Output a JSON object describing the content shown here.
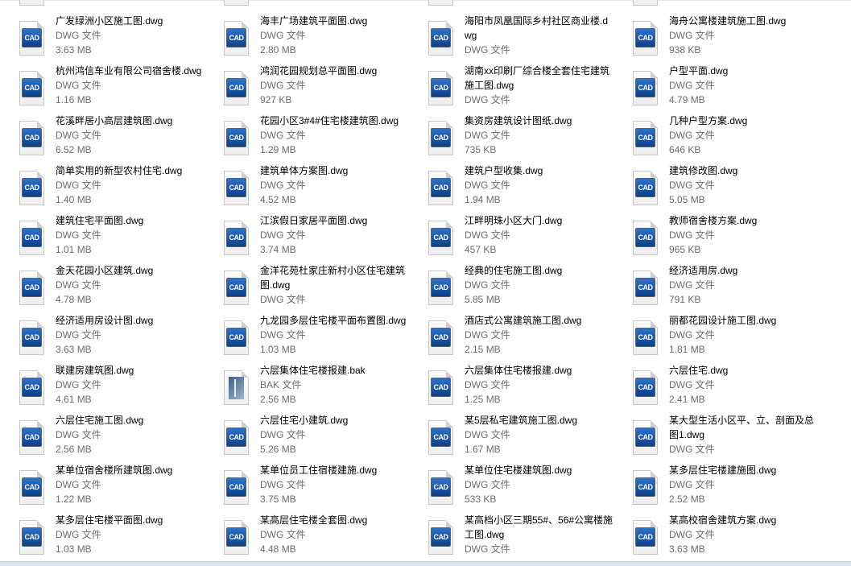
{
  "window": {
    "view": "tiles"
  },
  "icons": {
    "dwg": "cad-file-icon",
    "bak": "bak-file-icon",
    "cad_label": "CAD"
  },
  "colors": {
    "cad_blue": "#1f5cb0",
    "secondary_text": "#6d6d6d",
    "status_bar": "#dbe5f1"
  },
  "files": [
    {
      "name": "广发绿洲小区施工图.dwg",
      "type": "DWG 文件",
      "size": "3.63 MB",
      "kind": "dwg"
    },
    {
      "name": "海丰广场建筑平面图.dwg",
      "type": "DWG 文件",
      "size": "2.80 MB",
      "kind": "dwg"
    },
    {
      "name": "海阳市凤凰国际乡村社区商业楼.dwg",
      "type": "DWG 文件",
      "size": "",
      "kind": "dwg"
    },
    {
      "name": "海舟公寓楼建筑施工图.dwg",
      "type": "DWG 文件",
      "size": "938 KB",
      "kind": "dwg"
    },
    {
      "name": "杭州鸿信车业有限公司宿舍楼.dwg",
      "type": "DWG 文件",
      "size": "1.16 MB",
      "kind": "dwg"
    },
    {
      "name": "鸿润花园规划总平面图.dwg",
      "type": "DWG 文件",
      "size": "927 KB",
      "kind": "dwg"
    },
    {
      "name": "湖南xx印刷厂综合楼全套住宅建筑施工图.dwg",
      "type": "DWG 文件",
      "size": "",
      "kind": "dwg"
    },
    {
      "name": "户型平面.dwg",
      "type": "DWG 文件",
      "size": "4.79 MB",
      "kind": "dwg"
    },
    {
      "name": "花溪畔居小高层建筑图.dwg",
      "type": "DWG 文件",
      "size": "6.52 MB",
      "kind": "dwg"
    },
    {
      "name": "花园小区3#4#住宅楼建筑图.dwg",
      "type": "DWG 文件",
      "size": "1.29 MB",
      "kind": "dwg"
    },
    {
      "name": "集资房建筑设计图纸.dwg",
      "type": "DWG 文件",
      "size": "735 KB",
      "kind": "dwg"
    },
    {
      "name": "几种户型方案.dwg",
      "type": "DWG 文件",
      "size": "646 KB",
      "kind": "dwg"
    },
    {
      "name": "简单实用的新型农村住宅.dwg",
      "type": "DWG 文件",
      "size": "1.40 MB",
      "kind": "dwg"
    },
    {
      "name": "建筑单体方案图.dwg",
      "type": "DWG 文件",
      "size": "4.52 MB",
      "kind": "dwg"
    },
    {
      "name": "建筑户型收集.dwg",
      "type": "DWG 文件",
      "size": "1.94 MB",
      "kind": "dwg"
    },
    {
      "name": "建筑修改图.dwg",
      "type": "DWG 文件",
      "size": "5.05 MB",
      "kind": "dwg"
    },
    {
      "name": "建筑住宅平面图.dwg",
      "type": "DWG 文件",
      "size": "1.01 MB",
      "kind": "dwg"
    },
    {
      "name": "江滨假日家居平面图.dwg",
      "type": "DWG 文件",
      "size": "3.74 MB",
      "kind": "dwg"
    },
    {
      "name": "江畔明珠小区大门.dwg",
      "type": "DWG 文件",
      "size": "457 KB",
      "kind": "dwg"
    },
    {
      "name": "教师宿舍楼方案.dwg",
      "type": "DWG 文件",
      "size": "965 KB",
      "kind": "dwg"
    },
    {
      "name": "金天花园小区建筑.dwg",
      "type": "DWG 文件",
      "size": "4.78 MB",
      "kind": "dwg"
    },
    {
      "name": "金洋花苑杜家庄新村小区住宅建筑图.dwg",
      "type": "DWG 文件",
      "size": "",
      "kind": "dwg"
    },
    {
      "name": "经典的住宅施工图.dwg",
      "type": "DWG 文件",
      "size": "5.85 MB",
      "kind": "dwg"
    },
    {
      "name": "经济适用房.dwg",
      "type": "DWG 文件",
      "size": "791 KB",
      "kind": "dwg"
    },
    {
      "name": "经济适用房设计图.dwg",
      "type": "DWG 文件",
      "size": "3.63 MB",
      "kind": "dwg"
    },
    {
      "name": "九龙园多层住宅楼平面布置图.dwg",
      "type": "DWG 文件",
      "size": "1.03 MB",
      "kind": "dwg"
    },
    {
      "name": "酒店式公寓建筑施工图.dwg",
      "type": "DWG 文件",
      "size": "2.15 MB",
      "kind": "dwg"
    },
    {
      "name": "丽都花园设计施工图.dwg",
      "type": "DWG 文件",
      "size": "1.81 MB",
      "kind": "dwg"
    },
    {
      "name": "联建房建筑图.dwg",
      "type": "DWG 文件",
      "size": "4.61 MB",
      "kind": "dwg"
    },
    {
      "name": "六层集体住宅楼报建.bak",
      "type": "BAK 文件",
      "size": "2.56 MB",
      "kind": "bak"
    },
    {
      "name": "六层集体住宅楼报建.dwg",
      "type": "DWG 文件",
      "size": "1.25 MB",
      "kind": "dwg"
    },
    {
      "name": "六层住宅.dwg",
      "type": "DWG 文件",
      "size": "2.41 MB",
      "kind": "dwg"
    },
    {
      "name": "六层住宅施工图.dwg",
      "type": "DWG 文件",
      "size": "2.56 MB",
      "kind": "dwg"
    },
    {
      "name": "六层住宅小建筑.dwg",
      "type": "DWG 文件",
      "size": "5.26 MB",
      "kind": "dwg"
    },
    {
      "name": "某5层私宅建筑施工图.dwg",
      "type": "DWG 文件",
      "size": "1.67 MB",
      "kind": "dwg"
    },
    {
      "name": "某大型生活小区平、立、剖面及总图1.dwg",
      "type": "DWG 文件",
      "size": "",
      "kind": "dwg"
    },
    {
      "name": "某单位宿舍楼所建筑图.dwg",
      "type": "DWG 文件",
      "size": "1.22 MB",
      "kind": "dwg"
    },
    {
      "name": "某单位员工住宿楼建施.dwg",
      "type": "DWG 文件",
      "size": "3.75 MB",
      "kind": "dwg"
    },
    {
      "name": "某单位住宅楼建筑图.dwg",
      "type": "DWG 文件",
      "size": "533 KB",
      "kind": "dwg"
    },
    {
      "name": "某多层住宅楼建施图.dwg",
      "type": "DWG 文件",
      "size": "2.52 MB",
      "kind": "dwg"
    },
    {
      "name": "某多层住宅楼平面图.dwg",
      "type": "DWG 文件",
      "size": "1.03 MB",
      "kind": "dwg"
    },
    {
      "name": "某高层住宅楼全套图.dwg",
      "type": "DWG 文件",
      "size": "4.48 MB",
      "kind": "dwg"
    },
    {
      "name": "某高档小区三期55#、56#公寓楼施工图.dwg",
      "type": "DWG 文件",
      "size": "",
      "kind": "dwg"
    },
    {
      "name": "某高校宿舍建筑方案.dwg",
      "type": "DWG 文件",
      "size": "3.63 MB",
      "kind": "dwg"
    }
  ]
}
